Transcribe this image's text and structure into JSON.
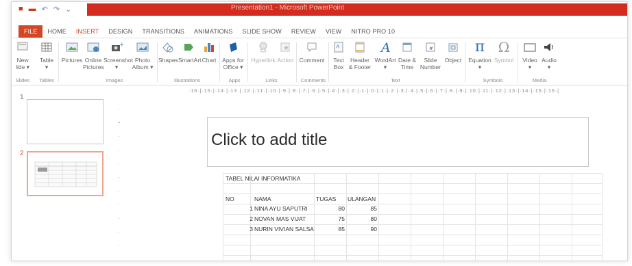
{
  "window": {
    "title": "Presentation1 - Microsoft PowerPoint"
  },
  "qat": {
    "icons": [
      "app-icon",
      "save-icon",
      "undo-icon",
      "redo-icon",
      "customize-icon"
    ]
  },
  "tabs": [
    "FILE",
    "HOME",
    "INSERT",
    "DESIGN",
    "TRANSITIONS",
    "ANIMATIONS",
    "SLIDE SHOW",
    "REVIEW",
    "VIEW",
    "NITRO PRO 10"
  ],
  "ribbon": {
    "new_slide": "New\nlide ▾",
    "table": "Table\n▾",
    "pictures": "Pictures",
    "online_pictures": "Online\nPictures",
    "screenshot": "Screenshot\n▾",
    "photo_album": "Photo\nAlbum ▾",
    "shapes": "Shapes",
    "smartart": "SmartArt",
    "chart": "Chart",
    "apps_for_office": "Apps for\nOffice ▾",
    "hyperlink": "Hyperlink",
    "action": "Action",
    "comment": "Comment",
    "text_box": "Text\nBox",
    "header_footer": "Header\n& Footer",
    "wordart": "WordArt\n▾",
    "date_time": "Date &\nTime",
    "slide_number": "Slide\nNumber",
    "object": "Object",
    "equation": "Equation\n▾",
    "symbol": "Symbol",
    "video": "Video\n▾",
    "audio": "Audio\n▾",
    "groups": {
      "slides": "Slides",
      "tables": "Tables",
      "images": "Images",
      "illustrations": "Illustrations",
      "apps": "Apps",
      "links": "Links",
      "comments": "Comments",
      "text": "Text",
      "symbols": "Symbols",
      "media": "Media"
    }
  },
  "ruler": "·16·|·15·|·14·|·13·|·12·|·11·|·10·|·9·|·8·|·7·|·6·|·5·|·4·|·3·|·2·|·1·|·0·|·1·|·2·|·3·|·4·|·5·|·6·|·7·|·8·|·9·|·10·|·11·|·12·|·13·|·14·|·15·|·16·|",
  "thumbnails": {
    "slide1_num": "1",
    "slide2_num": "2"
  },
  "slide": {
    "title_placeholder": "Click to add title",
    "sheet_title": "TABEL NILAI INFORMATIKA",
    "headers": {
      "no": "NO",
      "nama": "NAMA",
      "tugas": "TUGAS",
      "ulangan": "ULANGAN"
    },
    "rows": [
      {
        "no": "1",
        "nama": "NINA AYU SAPUTRI",
        "tugas": "80",
        "ulangan": "85"
      },
      {
        "no": "2",
        "nama": "NOVAN MAS VIJAT",
        "tugas": "75",
        "ulangan": "80"
      },
      {
        "no": "3",
        "nama": "NURIN VIVIAN SALSA",
        "tugas": "85",
        "ulangan": "90"
      }
    ]
  }
}
